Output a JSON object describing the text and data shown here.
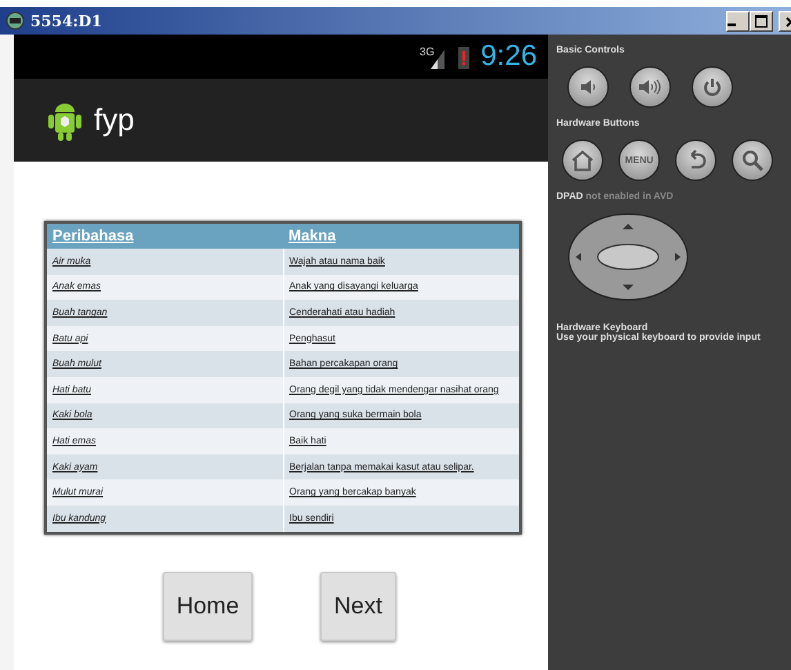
{
  "window": {
    "title": "5554:D1"
  },
  "status_bar": {
    "network": "3G",
    "time": "9:26"
  },
  "action_bar": {
    "title": "fyp"
  },
  "table": {
    "columns": [
      "Peribahasa",
      "Makna"
    ],
    "rows": [
      [
        "Air muka",
        "Wajah atau nama baik"
      ],
      [
        "Anak emas",
        "Anak yang disayangi keluarga"
      ],
      [
        "Buah tangan",
        "Cenderahati atau  hadiah"
      ],
      [
        "Batu api",
        "Penghasut"
      ],
      [
        "Buah mulut",
        "Bahan percakapan orang"
      ],
      [
        "Hati batu",
        "Orang degil yang tidak mendengar nasihat orang"
      ],
      [
        "Kaki bola",
        "Orang yang suka bermain bola"
      ],
      [
        "Hati emas",
        "Baik hati"
      ],
      [
        "Kaki ayam",
        "Berjalan tanpa memakai kasut atau selipar."
      ],
      [
        "Mulut murai",
        "Orang yang bercakap banyak"
      ],
      [
        "Ibu kandung",
        "Ibu sendiri"
      ]
    ]
  },
  "buttons": [
    "Home",
    "Next"
  ],
  "controls_panel": {
    "basic_controls_label": "Basic Controls",
    "hardware_buttons_label": "Hardware Buttons",
    "menu_button": "MENU",
    "dpad_label": "**DPAD** not enabled in AVD",
    "keyboard_title": "Hardware Keyboard",
    "keyboard_hint": "Use your physical keyboard to provide input"
  }
}
